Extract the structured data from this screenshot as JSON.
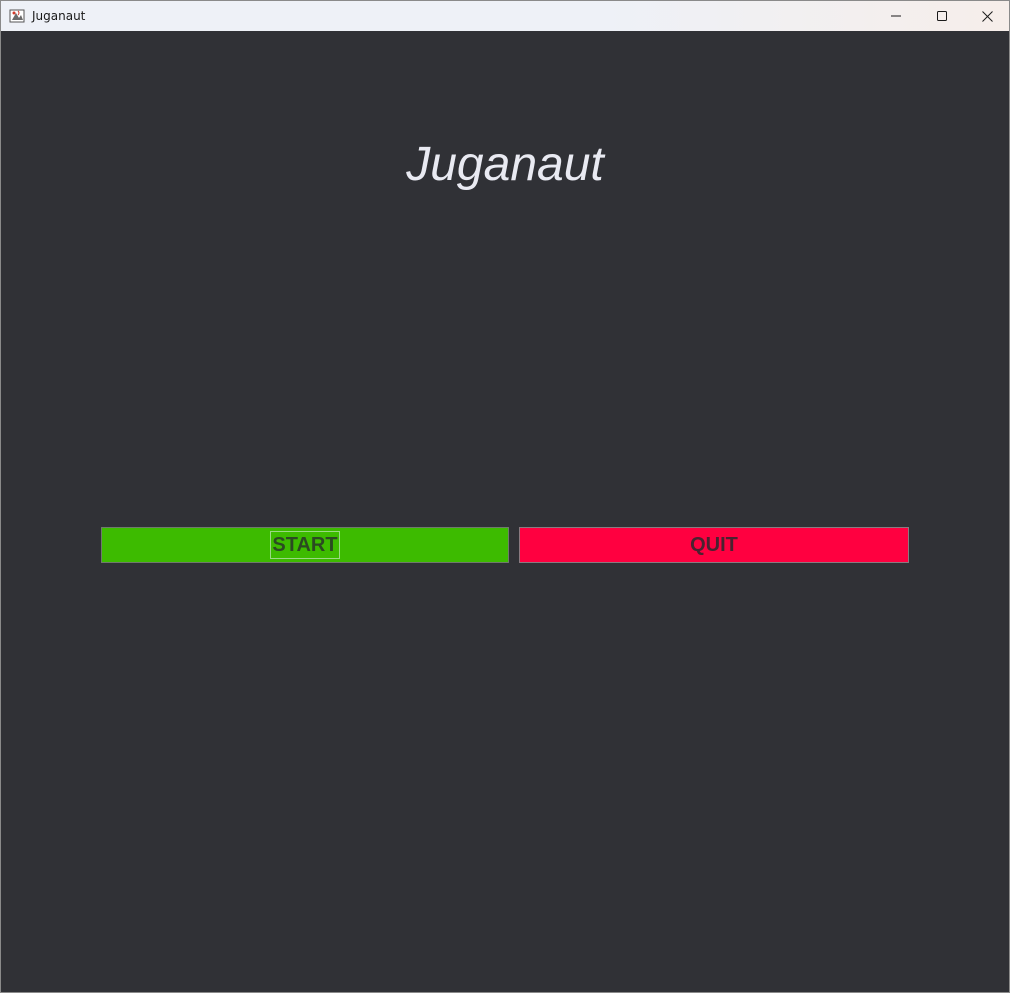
{
  "window": {
    "title": "Juganaut",
    "icon": "java-app-icon",
    "controls": {
      "minimize": "minimize-icon",
      "maximize": "maximize-icon",
      "close": "close-icon"
    }
  },
  "main": {
    "title": "Juganaut",
    "buttons": {
      "start_label": "START",
      "quit_label": "QUIT"
    }
  },
  "colors": {
    "background": "#303136",
    "title_text": "#e9eaf2",
    "start_button": "#3dbb00",
    "quit_button": "#ff0040"
  }
}
